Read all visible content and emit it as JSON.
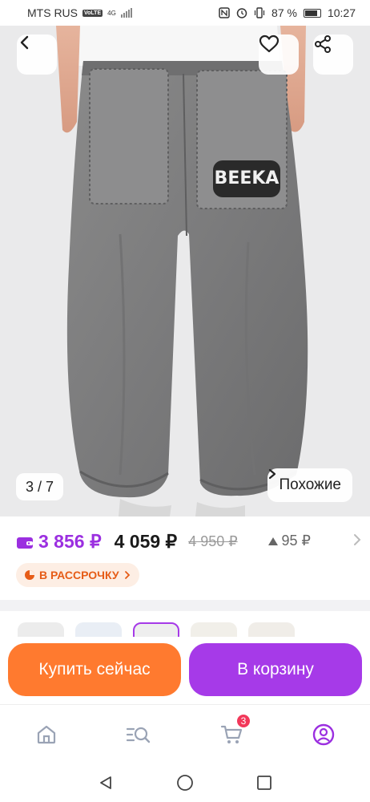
{
  "status_bar": {
    "carrier": "MTS RUS",
    "volte": "VoLTE",
    "network": "4G",
    "battery": "87 %",
    "time": "10:27"
  },
  "gallery": {
    "counter": "3 / 7",
    "similar_label": "Похожие",
    "current_index": 3,
    "total_images": 7,
    "pocket_print_text": "BEEKA"
  },
  "price": {
    "wallet_price": "3 856 ₽",
    "price": "4 059 ₽",
    "old_price": "4 950 ₽",
    "points": "95 ₽",
    "accent_color": "#9b2fe0"
  },
  "installment": {
    "label": "В РАССРОЧКУ",
    "color": "#e65c17"
  },
  "actions": {
    "buy_now": "Купить сейчас",
    "add_to_cart": "В корзину",
    "buy_color": "#ff7a2f",
    "cart_color": "#a63ae8"
  },
  "bottom_nav": {
    "items": [
      {
        "icon": "home-icon"
      },
      {
        "icon": "catalog-search-icon"
      },
      {
        "icon": "cart-icon",
        "badge": "3"
      },
      {
        "icon": "profile-icon"
      }
    ]
  },
  "system_nav": {
    "items": [
      "back-triangle-icon",
      "home-circle-icon",
      "recents-square-icon"
    ]
  }
}
